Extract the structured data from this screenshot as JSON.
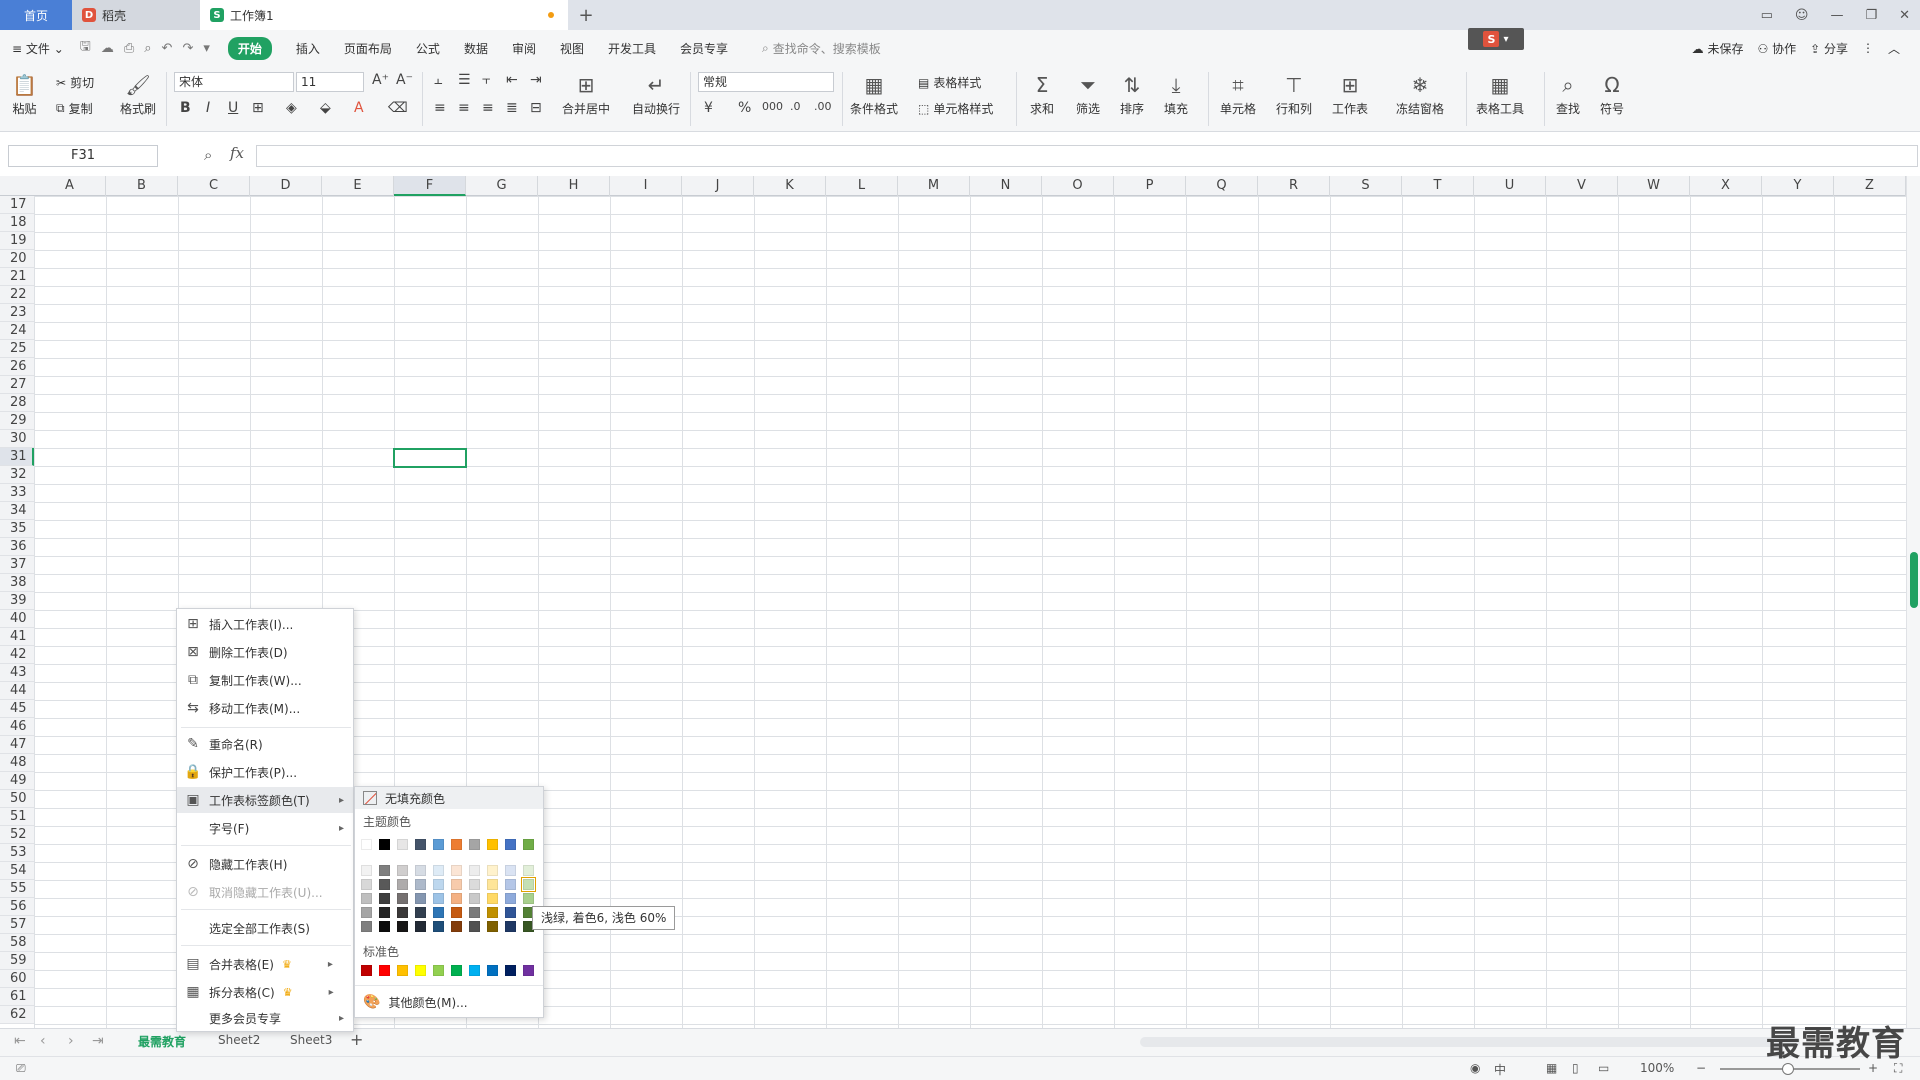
{
  "tabs": {
    "home": "首页",
    "daoke": "稻壳",
    "workbook": "工作簿1",
    "add": "+"
  },
  "menu": {
    "file": "文件",
    "items": [
      "开始",
      "插入",
      "页面布局",
      "公式",
      "数据",
      "审阅",
      "视图",
      "开发工具",
      "会员专享"
    ],
    "search_placeholder": "查找命令、搜索模板",
    "unsaved": "未保存",
    "collab": "协作",
    "share": "分享"
  },
  "ribbon": {
    "paste": "粘贴",
    "cut": "剪切",
    "copy": "复制",
    "format_painter": "格式刷",
    "font_name": "宋体",
    "font_size": "11",
    "merge_center": "合并居中",
    "auto_wrap": "自动换行",
    "number_format": "常规",
    "cond_format": "条件格式",
    "table_style": "表格样式",
    "cell_style": "单元格样式",
    "sum": "求和",
    "filter": "筛选",
    "sort": "排序",
    "fill": "填充",
    "cell": "单元格",
    "row_col": "行和列",
    "worksheet": "工作表",
    "freeze": "冻结窗格",
    "table_tools": "表格工具",
    "find": "查找",
    "symbol": "符号"
  },
  "formula_bar": {
    "name_box": "F31",
    "fx": "fx"
  },
  "grid": {
    "columns": [
      "A",
      "B",
      "C",
      "D",
      "E",
      "F",
      "G",
      "H",
      "I",
      "J",
      "K",
      "L",
      "M",
      "N",
      "O",
      "P",
      "Q",
      "R",
      "S",
      "T",
      "U",
      "V",
      "W",
      "X",
      "Y",
      "Z"
    ],
    "rows": [
      "17",
      "18",
      "19",
      "20",
      "21",
      "22",
      "23",
      "24",
      "25",
      "26",
      "27",
      "28",
      "29",
      "30",
      "31",
      "32",
      "33",
      "34",
      "35",
      "36",
      "37",
      "38",
      "39",
      "40",
      "41",
      "42",
      "43",
      "44",
      "45",
      "46",
      "47",
      "48",
      "49",
      "50",
      "51",
      "52",
      "53",
      "54",
      "55",
      "56",
      "57",
      "58",
      "59",
      "60",
      "61",
      "62"
    ],
    "selected_col": "F",
    "selected_row": "31"
  },
  "context_menu": {
    "insert_sheet": "插入工作表(I)...",
    "delete_sheet": "删除工作表(D)",
    "copy_sheet": "复制工作表(W)...",
    "move_sheet": "移动工作表(M)...",
    "rename": "重命名(R)",
    "protect": "保护工作表(P)...",
    "tab_color": "工作表标签颜色(T)",
    "font_size": "字号(F)",
    "hide": "隐藏工作表(H)",
    "unhide": "取消隐藏工作表(U)...",
    "select_all": "选定全部工作表(S)",
    "merge_tables": "合并表格(E)",
    "split_tables": "拆分表格(C)",
    "more_member": "更多会员专享"
  },
  "color_submenu": {
    "no_fill": "无填充颜色",
    "theme_colors": "主题颜色",
    "standard_colors": "标准色",
    "more_colors": "其他颜色(M)...",
    "theme_top": [
      "#ffffff",
      "#000000",
      "#e7e6e6",
      "#44546a",
      "#5b9bd5",
      "#ed7d31",
      "#a5a5a5",
      "#ffc000",
      "#4472c4",
      "#70ad47"
    ],
    "theme_shades": [
      [
        "#f2f2f2",
        "#7f7f7f",
        "#d0cece",
        "#d6dce4",
        "#deebf6",
        "#fbe5d5",
        "#ededed",
        "#fff2cc",
        "#dae3f3",
        "#e2efd9"
      ],
      [
        "#d8d8d8",
        "#595959",
        "#aeabab",
        "#adb9ca",
        "#bdd7ee",
        "#f7cbac",
        "#dbdbdb",
        "#fee599",
        "#b4c6e7",
        "#c5e0b3"
      ],
      [
        "#bfbfbf",
        "#3f3f3f",
        "#757070",
        "#8496b0",
        "#9dc3e6",
        "#f4b183",
        "#c9c9c9",
        "#ffd965",
        "#8eaadb",
        "#a8d08d"
      ],
      [
        "#a5a5a5",
        "#262626",
        "#3a3838",
        "#323f4f",
        "#2e75b5",
        "#c55a11",
        "#7b7b7b",
        "#bf9000",
        "#2f5496",
        "#538135"
      ],
      [
        "#7f7f7f",
        "#0c0c0c",
        "#171616",
        "#222a35",
        "#1e4e79",
        "#833c0b",
        "#525252",
        "#7f6000",
        "#1f3864",
        "#375623"
      ]
    ],
    "standard": [
      "#c00000",
      "#ff0000",
      "#ffc000",
      "#ffff00",
      "#92d050",
      "#00b050",
      "#00b0f0",
      "#0070c0",
      "#002060",
      "#7030a0"
    ],
    "tooltip": "浅绿, 着色6, 浅色 60%"
  },
  "sheets": {
    "tabs": [
      "最需教育",
      "Sheet2",
      "Sheet3"
    ],
    "active": "最需教育",
    "add": "+"
  },
  "status": {
    "zoom": "100%"
  },
  "watermark": "最需教育",
  "colors": {
    "accent": "#20a162",
    "home_tab": "#4a7fd6"
  }
}
